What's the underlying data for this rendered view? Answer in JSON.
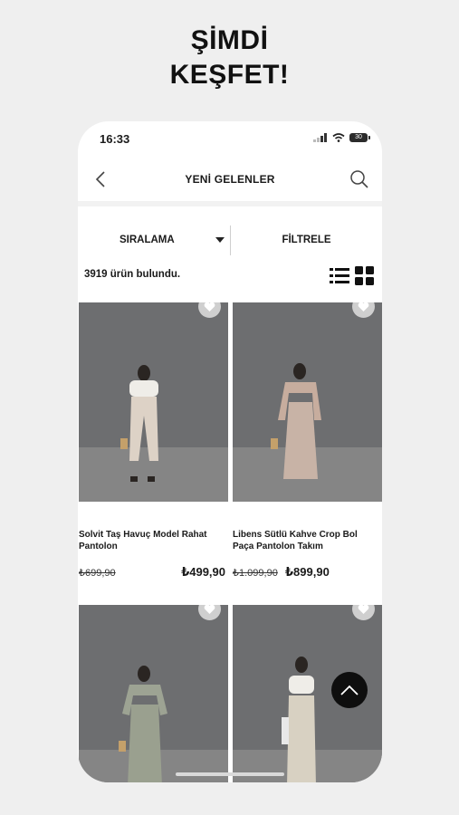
{
  "promo": {
    "line1": "ŞİMDİ",
    "line2": "KEŞFET!"
  },
  "status_bar": {
    "time": "16:33",
    "battery": "30"
  },
  "navbar": {
    "title": "YENİ GELENLER",
    "icons": [
      "chevron-left-icon",
      "search-icon"
    ]
  },
  "toolbar": {
    "sort_label": "SIRALAMA",
    "filter_label": "FİLTRELE"
  },
  "results": {
    "count_text": "3919  ürün bulundu."
  },
  "products": [
    {
      "name": "Solvit Taş Havuç Model Rahat Pantolon",
      "old_price": "₺699,90",
      "price": "₺499,90"
    },
    {
      "name": "Libens Sütlü Kahve Crop Bol Paça Pantolon Takım",
      "old_price": "₺1.099,90",
      "price": "₺899,90"
    },
    {
      "name": "",
      "old_price": "",
      "price": ""
    },
    {
      "name": "",
      "old_price": "",
      "price": ""
    }
  ],
  "colors": {
    "accent": "#111111",
    "favorite_bg": "#cfcfcf",
    "background": "#efefef"
  }
}
